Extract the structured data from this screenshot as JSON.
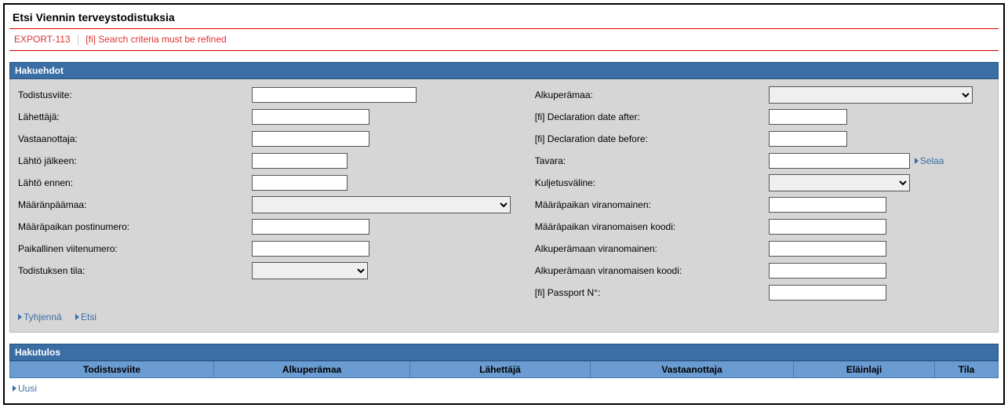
{
  "page_title": "Etsi Viennin terveystodistuksia",
  "error": {
    "code": "EXPORT-113",
    "message": "[fi] Search criteria must be refined"
  },
  "sections": {
    "criteria": "Hakuehdot",
    "results": "Hakutulos"
  },
  "labels": {
    "todistusviite": "Todistusviite:",
    "lahettaja": "Lähettäjä:",
    "vastaanottaja": "Vastaanottaja:",
    "lahto_jalkeen": "Lähtö jälkeen:",
    "lahto_ennen": "Lähtö ennen:",
    "maaranpaamaa": "Määränpäämaa:",
    "maarapaikan_postinumero": "Määräpaikan postinumero:",
    "paikallinen_viitenumero": "Paikallinen viitenumero:",
    "todistuksen_tila": "Todistuksen tila:",
    "alkuperamaa": "Alkuperämaa:",
    "decl_date_after": "[fi] Declaration date after:",
    "decl_date_before": "[fi] Declaration date before:",
    "tavara": "Tavara:",
    "kuljetusvaline": "Kuljetusväline:",
    "maarapaikan_viranomainen": "Määräpaikan viranomainen:",
    "maarapaikan_viranomaisen_koodi": "Määräpaikan viranomaisen koodi:",
    "alkuperamaan_viranomainen": "Alkuperämaan viranomainen:",
    "alkuperamaan_viranomaisen_koodi": "Alkuperämaan viranomaisen koodi:",
    "passport_no": "[fi] Passport N°:"
  },
  "actions": {
    "tyhjenna": "Tyhjennä",
    "etsi": "Etsi",
    "uusi": "Uusi",
    "selaa": "Selaa"
  },
  "results_columns": {
    "todistusviite": "Todistusviite",
    "alkuperamaa": "Alkuperämaa",
    "lahettaja": "Lähettäjä",
    "vastaanottaja": "Vastaanottaja",
    "elainlaji": "Eläinlaji",
    "tila": "Tila"
  },
  "values": {
    "todistusviite": "",
    "lahettaja": "",
    "vastaanottaja": "",
    "lahto_jalkeen": "",
    "lahto_ennen": "",
    "maaranpaamaa": "",
    "maarapaikan_postinumero": "",
    "paikallinen_viitenumero": "",
    "todistuksen_tila": "",
    "alkuperamaa": "",
    "decl_date_after": "",
    "decl_date_before": "",
    "tavara": "",
    "kuljetusvaline": "",
    "maarapaikan_viranomainen": "",
    "maarapaikan_viranomaisen_koodi": "",
    "alkuperamaan_viranomainen": "",
    "alkuperamaan_viranomaisen_koodi": "",
    "passport_no": ""
  }
}
